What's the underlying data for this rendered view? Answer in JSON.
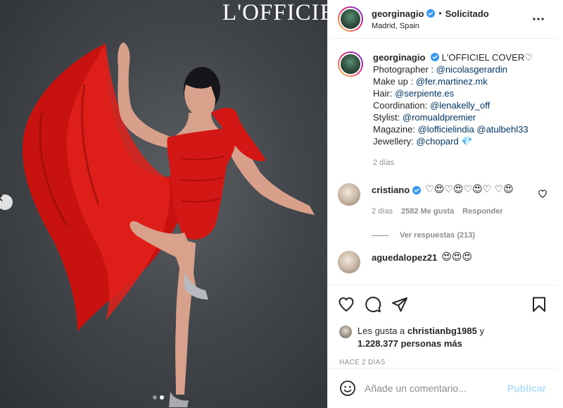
{
  "photo": {
    "magazine_logo": "L'OFFICIEL",
    "total_slides": 2,
    "active_slide": 2,
    "nav_prev_icon": "chevron-left-icon"
  },
  "header": {
    "username": "georginagio",
    "verified_icon": "verified-badge-icon",
    "separator": "•",
    "follow_status": "Solicitado",
    "location": "Madrid, Spain",
    "more_icon": "more-options-icon"
  },
  "caption": {
    "username": "georginagio",
    "title": "L'OFFICIEL COVER♡",
    "lines": [
      {
        "label": "Photographer : ",
        "mentions": "@nicolasgerardin"
      },
      {
        "label": "Make up : ",
        "mentions": "@fer.martinez.mk"
      },
      {
        "label": "Hair: ",
        "mentions": "@serpiente.es"
      },
      {
        "label": "Coordination: ",
        "mentions": "@lenakelly_off"
      },
      {
        "label": "Stylist: ",
        "mentions": "@romualdpremier"
      },
      {
        "label": "Magazine: ",
        "mentions": "@lofficielindia @atulbehl33"
      },
      {
        "label": "Jewellery: ",
        "mentions": "@chopard 💎"
      }
    ],
    "time_ago": "2 días"
  },
  "comments": [
    {
      "username": "cristiano",
      "text": "♡😍♡😍♡😍♡ ♡😍",
      "time_ago": "2 días",
      "likes": "2582 Me gusta",
      "reply_label": "Responder",
      "view_replies": "Ver respuestas (213)"
    },
    {
      "username": "aguedalopez21",
      "text": "😍😍😍"
    }
  ],
  "actions": {
    "like_icon": "heart-icon",
    "comment_icon": "comment-icon",
    "share_icon": "share-icon",
    "save_icon": "bookmark-icon"
  },
  "likes": {
    "prefix": "Les gusta a ",
    "friend": "christianbg1985",
    "connector": " y",
    "others": "1.228.377 personas más"
  },
  "timestamp": "HACE 2 DÍAS",
  "add_comment": {
    "emoji_icon": "emoji-icon",
    "placeholder": "Añade un comentario...",
    "publish_label": "Publicar"
  },
  "colors": {
    "verified": "#3897f0",
    "mention": "#00376b",
    "publish_disabled": "#b2dffc",
    "dress": "#d31714"
  }
}
